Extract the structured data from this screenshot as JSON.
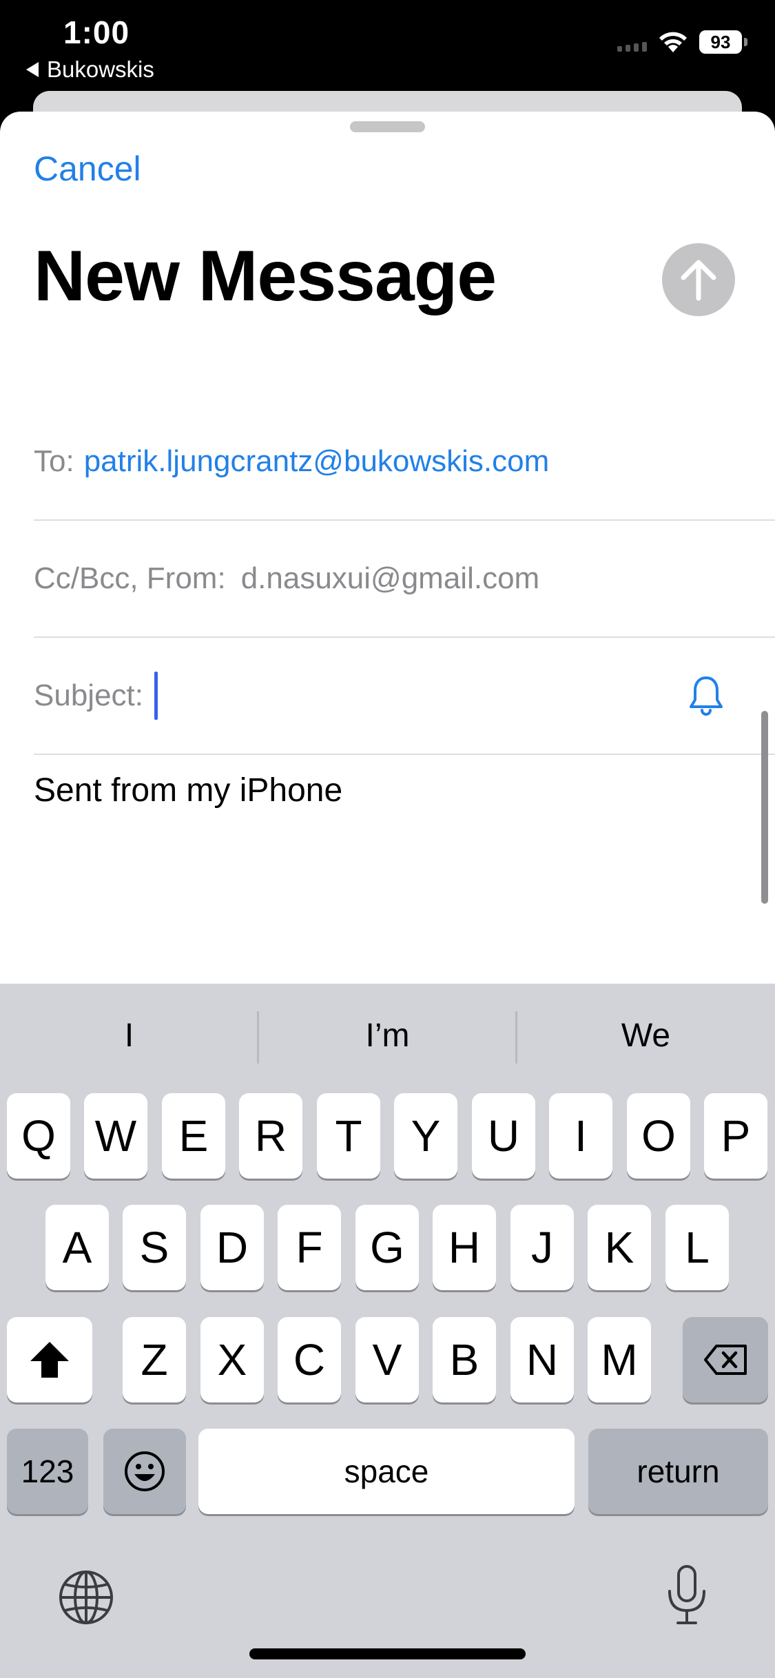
{
  "status_bar": {
    "time": "1:00",
    "back_app": "Bukowskis",
    "battery": "93"
  },
  "compose": {
    "cancel_label": "Cancel",
    "title": "New Message",
    "to_label": "To:",
    "to_value": "patrik.ljungcrantz@bukowskis.com",
    "cc_label": "Cc/Bcc, From:",
    "from_value": "d.nasuxui@gmail.com",
    "subject_label": "Subject:",
    "subject_value": "",
    "body": "Sent from my iPhone"
  },
  "keyboard": {
    "suggestions": [
      "I",
      "I’m",
      "We"
    ],
    "row1": [
      "Q",
      "W",
      "E",
      "R",
      "T",
      "Y",
      "U",
      "I",
      "O",
      "P"
    ],
    "row2": [
      "A",
      "S",
      "D",
      "F",
      "G",
      "H",
      "J",
      "K",
      "L"
    ],
    "row3": [
      "Z",
      "X",
      "C",
      "V",
      "B",
      "N",
      "M"
    ],
    "numbers_label": "123",
    "space_label": "space",
    "return_label": "return"
  },
  "colors": {
    "accent": "#2180e8",
    "caret": "#3a62e8",
    "keyboard_bg": "#d1d3d9"
  }
}
